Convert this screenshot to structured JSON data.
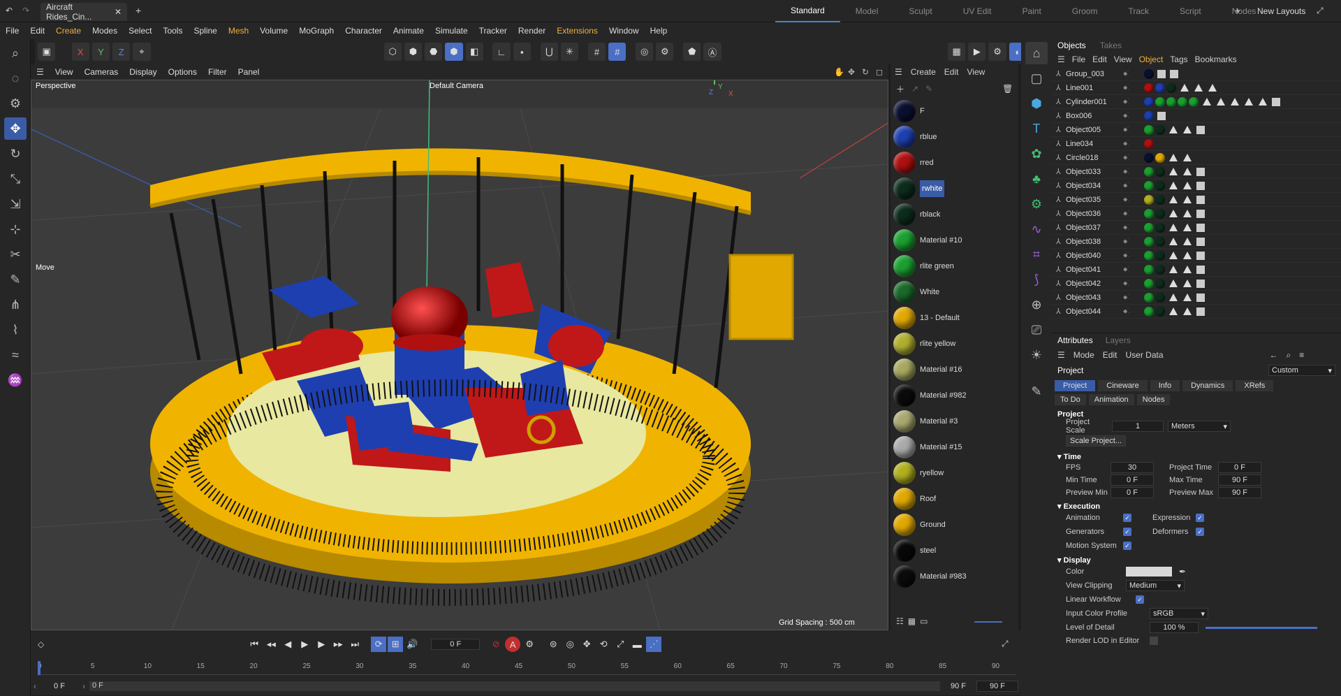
{
  "titlebar": {
    "doc_tab": "Aircraft Rides_Cin...",
    "layouts": [
      "Standard",
      "Model",
      "Sculpt",
      "UV Edit",
      "Paint",
      "Groom",
      "Track",
      "Script",
      "Nodes"
    ],
    "new_layouts": "New Layouts"
  },
  "menu": [
    "File",
    "Edit",
    "Create",
    "Modes",
    "Select",
    "Tools",
    "Spline",
    "Mesh",
    "Volume",
    "MoGraph",
    "Character",
    "Animate",
    "Simulate",
    "Tracker",
    "Render",
    "Extensions",
    "Window",
    "Help"
  ],
  "toolbar": {
    "axes": [
      "X",
      "Y",
      "Z"
    ]
  },
  "viewport_menu": [
    "View",
    "Cameras",
    "Display",
    "Options",
    "Filter",
    "Panel"
  ],
  "viewport": {
    "label": "Perspective",
    "camera": "Default Camera",
    "move_label": "Move",
    "grid": "Grid Spacing : 500 cm"
  },
  "materials": {
    "menu": [
      "Create",
      "Edit",
      "View"
    ],
    "items": [
      {
        "name": "F",
        "color": "#0a1030"
      },
      {
        "name": "rblue",
        "color": "#1e3fb0"
      },
      {
        "name": "rred",
        "color": "#b01010"
      },
      {
        "name": "rwhite",
        "color": "#0d2c1c"
      },
      {
        "name": "rblack",
        "color": "#0d2c1c"
      },
      {
        "name": "Material #10",
        "color": "#1aa030"
      },
      {
        "name": "rlite green",
        "color": "#1aa030"
      },
      {
        "name": "White",
        "color": "#1a6a2a"
      },
      {
        "name": "13 - Default",
        "color": "#e0a800"
      },
      {
        "name": "rlite yellow",
        "color": "#b0b030"
      },
      {
        "name": "Material #16",
        "color": "#a8a860"
      },
      {
        "name": "Material #982",
        "color": "#0b0b0b"
      },
      {
        "name": "Material #3",
        "color": "#a8a870"
      },
      {
        "name": "Material #15",
        "color": "#aaaaaa"
      },
      {
        "name": "ryellow",
        "color": "#b0b020"
      },
      {
        "name": "Roof",
        "color": "#e0a800"
      },
      {
        "name": "Ground",
        "color": "#e0a800"
      },
      {
        "name": "steel",
        "color": "#080808"
      },
      {
        "name": "Material #983",
        "color": "#0b0b0b"
      }
    ]
  },
  "objects": {
    "tabs": [
      "Objects",
      "Takes"
    ],
    "menu": [
      "File",
      "Edit",
      "View",
      "Object",
      "Tags",
      "Bookmarks"
    ],
    "rows": [
      {
        "name": "Group_003",
        "tags": [
          "#0a1030",
          "sq",
          "sq"
        ]
      },
      {
        "name": "Line001",
        "tags": [
          "#b01010",
          "#1e3fb0",
          "#0d2c1c",
          "tri",
          "tri",
          "tri"
        ]
      },
      {
        "name": "Cylinder001",
        "tags": [
          "#1e3fb0",
          "#1aa030",
          "#1aa030",
          "#1aa030",
          "#1aa030",
          "tri",
          "tri",
          "tri",
          "tri",
          "tri",
          "sq"
        ]
      },
      {
        "name": "Box006",
        "tags": [
          "#1e3fb0",
          "sq"
        ]
      },
      {
        "name": "Object005",
        "tags": [
          "#1aa030",
          "#0d2c1c",
          "tri",
          "tri",
          "sq"
        ]
      },
      {
        "name": "Line034",
        "tags": [
          "#b01010"
        ]
      },
      {
        "name": "Circle018",
        "tags": [
          "#0a1030",
          "#e0a800",
          "tri",
          "tri"
        ]
      },
      {
        "name": "Object033",
        "tags": [
          "#1aa030",
          "#0d2c1c",
          "tri",
          "tri",
          "sq"
        ]
      },
      {
        "name": "Object034",
        "tags": [
          "#1aa030",
          "#0d2c1c",
          "tri",
          "tri",
          "sq"
        ]
      },
      {
        "name": "Object035",
        "tags": [
          "#b0b020",
          "#0d2c1c",
          "tri",
          "tri",
          "sq"
        ]
      },
      {
        "name": "Object036",
        "tags": [
          "#1aa030",
          "#0d2c1c",
          "tri",
          "tri",
          "sq"
        ]
      },
      {
        "name": "Object037",
        "tags": [
          "#1aa030",
          "#0d2c1c",
          "tri",
          "tri",
          "sq"
        ]
      },
      {
        "name": "Object038",
        "tags": [
          "#1aa030",
          "#0d2c1c",
          "tri",
          "tri",
          "sq"
        ]
      },
      {
        "name": "Object040",
        "tags": [
          "#1aa030",
          "#0d2c1c",
          "tri",
          "tri",
          "sq"
        ]
      },
      {
        "name": "Object041",
        "tags": [
          "#1aa030",
          "#0d2c1c",
          "tri",
          "tri",
          "sq"
        ]
      },
      {
        "name": "Object042",
        "tags": [
          "#1aa030",
          "#0d2c1c",
          "tri",
          "tri",
          "sq"
        ]
      },
      {
        "name": "Object043",
        "tags": [
          "#1aa030",
          "#0d2c1c",
          "tri",
          "tri",
          "sq"
        ]
      },
      {
        "name": "Object044",
        "tags": [
          "#1aa030",
          "#0d2c1c",
          "tri",
          "tri",
          "sq"
        ]
      }
    ]
  },
  "attributes": {
    "tabs": [
      "Attributes",
      "Layers"
    ],
    "menu": [
      "Mode",
      "Edit",
      "User Data"
    ],
    "title": "Project",
    "preset": "Custom",
    "subtabs": [
      "Project",
      "Cineware",
      "Info",
      "Dynamics",
      "XRefs"
    ],
    "subtabs2": [
      "To Do",
      "Animation",
      "Nodes"
    ],
    "section": "Project",
    "scale_label": "Project Scale",
    "scale": "1",
    "unit": "Meters",
    "scale_btn": "Scale Project...",
    "time": {
      "header": "Time",
      "fps_l": "FPS",
      "fps": "30",
      "ptime_l": "Project Time",
      "ptime": "0 F",
      "min_l": "Min Time",
      "min": "0 F",
      "max_l": "Max Time",
      "max": "90 F",
      "pmin_l": "Preview Min",
      "pmin": "0 F",
      "pmax_l": "Preview Max",
      "pmax": "90 F"
    },
    "exec": {
      "header": "Execution",
      "anim": "Animation",
      "expr": "Expression",
      "gen": "Generators",
      "def": "Deformers",
      "motion": "Motion System"
    },
    "display": {
      "header": "Display",
      "color": "Color",
      "clip": "View Clipping",
      "clip_val": "Medium",
      "linear": "Linear Workflow",
      "profile": "Input Color Profile",
      "profile_val": "sRGB",
      "lod": "Level of Detail",
      "lod_val": "100 %",
      "render_lod": "Render LOD in Editor"
    }
  },
  "timeline": {
    "frame": "0 F",
    "ticks": [
      "0",
      "5",
      "10",
      "15",
      "20",
      "25",
      "30",
      "35",
      "40",
      "45",
      "50",
      "55",
      "60",
      "65",
      "70",
      "75",
      "80",
      "85",
      "90"
    ],
    "start": "0 F",
    "start2": "0 F",
    "end": "90 F",
    "end2": "90 F"
  }
}
